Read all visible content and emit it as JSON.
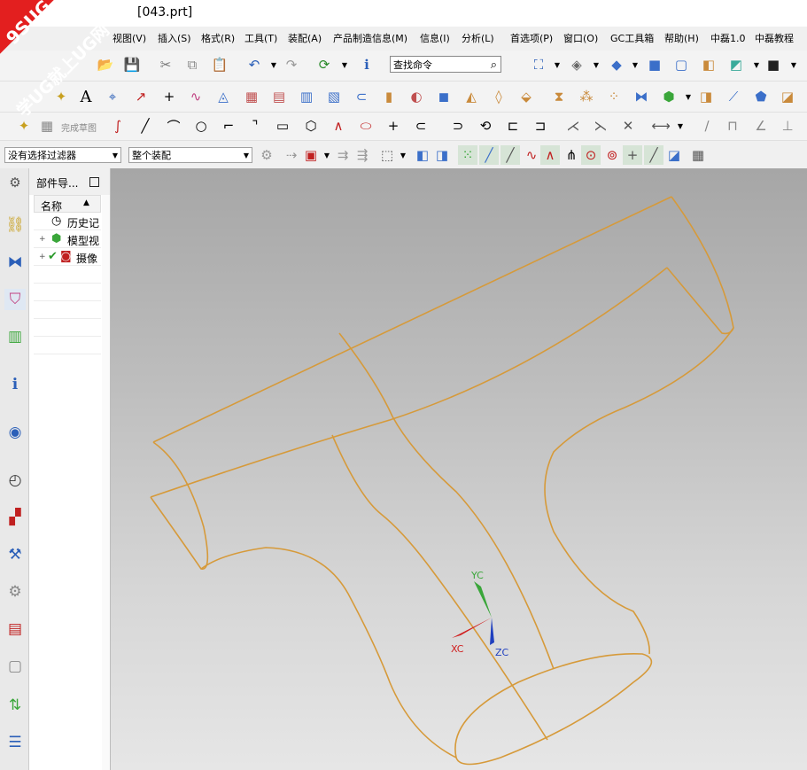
{
  "window": {
    "title": "[043.prt]"
  },
  "watermark": {
    "line1": "9SUG",
    "line2": "学UG就上UG网"
  },
  "menu": [
    "视图(V)",
    "插入(S)",
    "格式(R)",
    "工具(T)",
    "装配(A)",
    "产品制造信息(M)",
    "信息(I)",
    "分析(L)",
    "首选项(P)",
    "窗口(O)",
    "GC工具箱",
    "帮助(H)",
    "中磊1.0",
    "中磊教程"
  ],
  "toolbar": {
    "search_placeholder": "查找命令",
    "sketch_finish_label": "完成草图",
    "filter_select": "没有选择过滤器",
    "scope_select": "整个装配"
  },
  "part_navigator": {
    "title": "部件导...",
    "column_name": "名称",
    "items": [
      "历史记",
      "模型视",
      "摄像"
    ]
  },
  "axes": {
    "y": "YC",
    "x": "XC",
    "z": "ZC",
    "y_color": "#3aa63a",
    "x_color": "#d02020",
    "z_color": "#1f3fbf"
  },
  "colors": {
    "model_edges": "#d69a3a",
    "brand": "#e31f1f"
  }
}
